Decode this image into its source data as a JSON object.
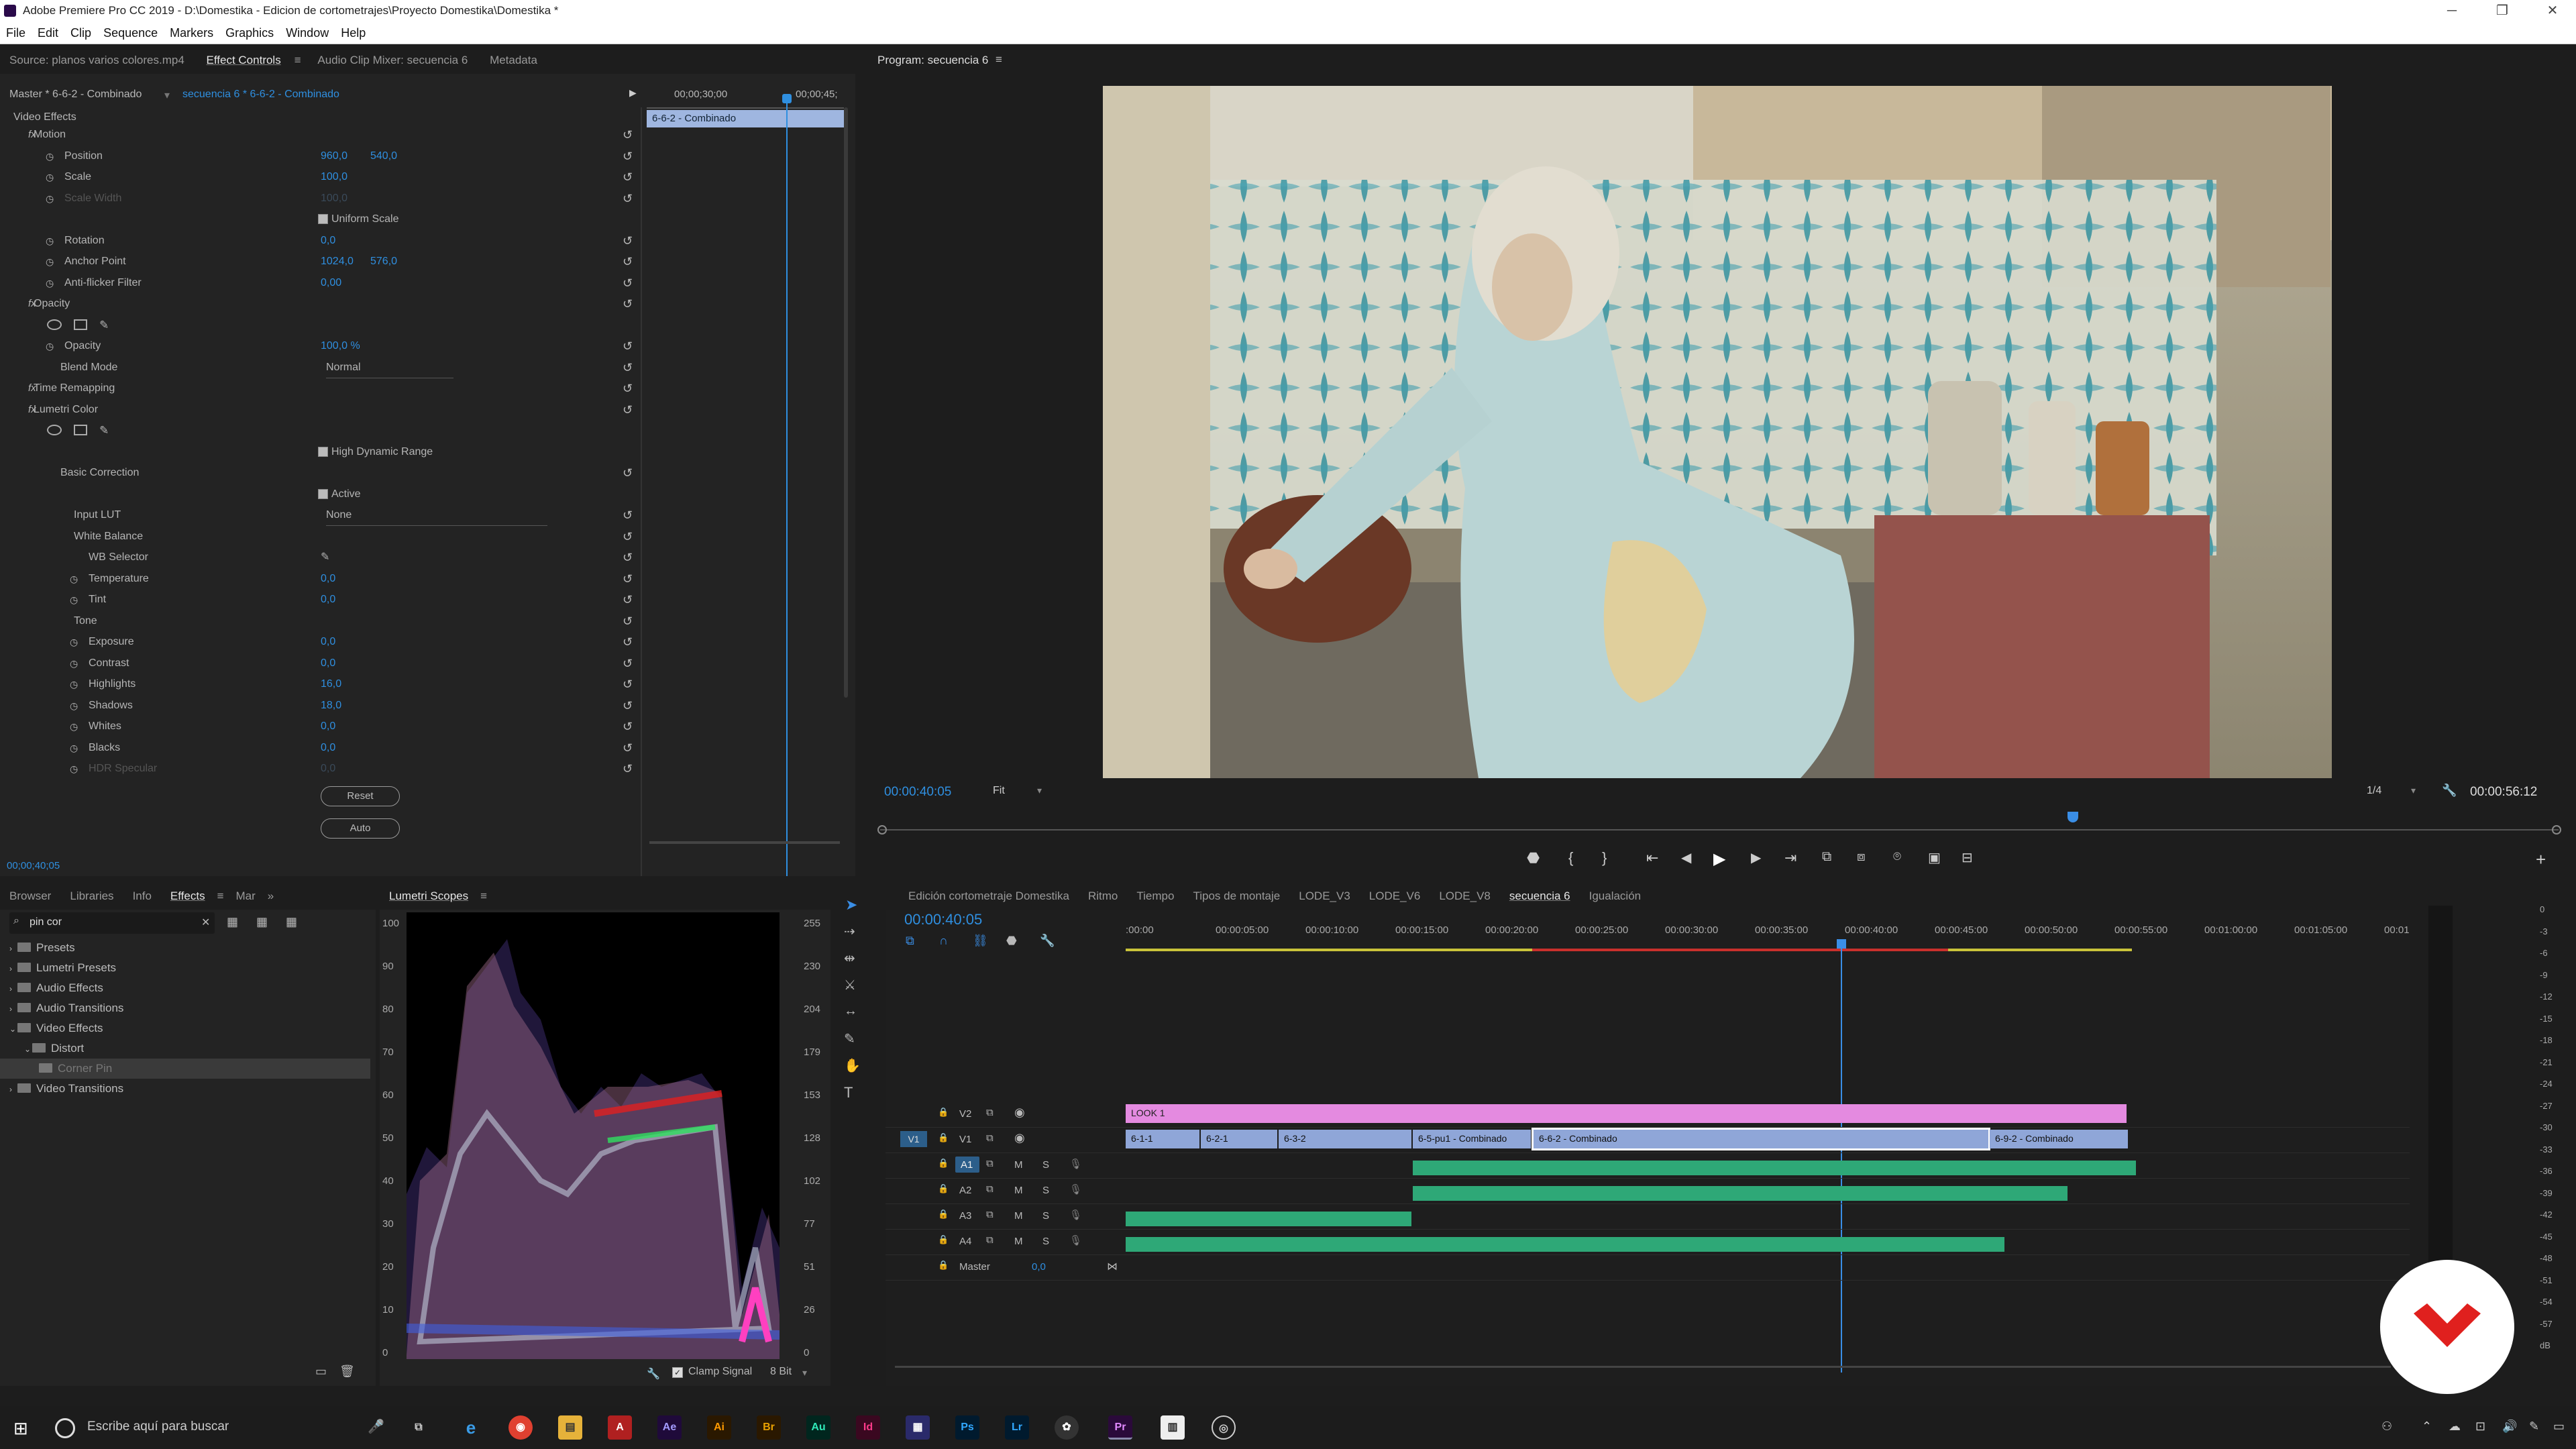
{
  "window": {
    "title": "Adobe Premiere Pro CC 2019 - D:\\Domestika - Edicion de cortometrajes\\Proyecto Domestika\\Domestika *"
  },
  "menu": [
    "File",
    "Edit",
    "Clip",
    "Sequence",
    "Markers",
    "Graphics",
    "Window",
    "Help"
  ],
  "source_panel": {
    "tabs": [
      "Source: planos varios colores.mp4",
      "Effect Controls",
      "Audio Clip Mixer: secuencia 6",
      "Metadata"
    ],
    "active_tab": 1,
    "master": "Master * 6-6-2 - Combinado",
    "sequence": "secuencia 6 * 6-6-2 - Combinado",
    "ruler": [
      "00;00;30;00",
      "00;00;45;"
    ],
    "clip_bar": "6-6-2 - Combinado",
    "timecode": "00;00;40;05",
    "section": "Video Effects",
    "rows": [
      {
        "label": "Motion",
        "indent": 50,
        "fx": true
      },
      {
        "label": "Position",
        "indent": 96,
        "v1": "960,0",
        "v2": "540,0"
      },
      {
        "label": "Scale",
        "indent": 96,
        "v1": "100,0"
      },
      {
        "label": "Scale Width",
        "indent": 96,
        "v1": "100,0",
        "dim": true
      },
      {
        "label": "Uniform Scale",
        "indent": 490,
        "check": true
      },
      {
        "label": "Rotation",
        "indent": 96,
        "v1": "0,0"
      },
      {
        "label": "Anchor Point",
        "indent": 96,
        "v1": "1024,0",
        "v2": "576,0"
      },
      {
        "label": "Anti-flicker Filter",
        "indent": 96,
        "v1": "0,00"
      },
      {
        "label": "Opacity",
        "indent": 50,
        "fx": true
      },
      {
        "label": "",
        "indent": 0,
        "masks": true
      },
      {
        "label": "Opacity",
        "indent": 96,
        "v1": "100,0 %"
      },
      {
        "label": "Blend Mode",
        "indent": 90,
        "sel": "Normal"
      },
      {
        "label": "Time Remapping",
        "indent": 50,
        "fx": true
      },
      {
        "label": "Lumetri Color",
        "indent": 50,
        "fx": true
      },
      {
        "label": "",
        "indent": 0,
        "masks": true
      },
      {
        "label": "High Dynamic Range",
        "indent": 490,
        "check": true
      },
      {
        "label": "Basic Correction",
        "indent": 90
      },
      {
        "label": "Active",
        "indent": 490,
        "check": true
      },
      {
        "label": "Input LUT",
        "indent": 110,
        "sel": "None"
      },
      {
        "label": "White Balance",
        "indent": 110
      },
      {
        "label": "WB Selector",
        "indent": 132
      },
      {
        "label": "Temperature",
        "indent": 132,
        "v1": "0,0"
      },
      {
        "label": "Tint",
        "indent": 132,
        "v1": "0,0"
      },
      {
        "label": "Tone",
        "indent": 110
      },
      {
        "label": "Exposure",
        "indent": 132,
        "v1": "0,0"
      },
      {
        "label": "Contrast",
        "indent": 132,
        "v1": "0,0"
      },
      {
        "label": "Highlights",
        "indent": 132,
        "v1": "16,0"
      },
      {
        "label": "Shadows",
        "indent": 132,
        "v1": "18,0"
      },
      {
        "label": "Whites",
        "indent": 132,
        "v1": "0,0"
      },
      {
        "label": "Blacks",
        "indent": 132,
        "v1": "0,0"
      },
      {
        "label": "HDR Specular",
        "indent": 132,
        "v1": "0,0",
        "dim": true
      }
    ],
    "reset_label": "Reset",
    "auto_label": "Auto"
  },
  "program": {
    "title": "Program: secuencia 6",
    "timecode": "00:00:40:05",
    "fit": "Fit",
    "quality": "1/4",
    "duration": "00:00:56:12"
  },
  "effects_panel": {
    "tabs": [
      "Browser",
      "Libraries",
      "Info",
      "Effects",
      "Mar"
    ],
    "search": "pin cor",
    "tree": [
      {
        "label": "Presets",
        "depth": 0
      },
      {
        "label": "Lumetri Presets",
        "depth": 0
      },
      {
        "label": "Audio Effects",
        "depth": 0
      },
      {
        "label": "Audio Transitions",
        "depth": 0
      },
      {
        "label": "Video Effects",
        "depth": 0
      },
      {
        "label": "Distort",
        "depth": 1
      },
      {
        "label": "Corner Pin",
        "depth": 2,
        "selected": true
      },
      {
        "label": "Video Transitions",
        "depth": 0
      }
    ]
  },
  "scopes": {
    "title": "Lumetri Scopes",
    "left_ticks": [
      "100",
      "90",
      "80",
      "70",
      "60",
      "50",
      "40",
      "30",
      "20",
      "10",
      "0"
    ],
    "right_ticks": [
      "255",
      "230",
      "204",
      "179",
      "153",
      "128",
      "102",
      "77",
      "51",
      "26",
      "0"
    ],
    "clamp": "Clamp Signal",
    "bit": "8 Bit"
  },
  "timeline": {
    "tabs": [
      "Edición cortometraje Domestika",
      "Ritmo",
      "Tiempo",
      "Tipos de montaje",
      "LODE_V3",
      "LODE_V6",
      "LODE_V8",
      "secuencia 6",
      "Igualación"
    ],
    "active_tab": 7,
    "timecode": "00:00:40:05",
    "ruler": [
      ":00:00",
      "00:00:05:00",
      "00:00:10:00",
      "00:00:15:00",
      "00:00:20:00",
      "00:00:25:00",
      "00:00:30:00",
      "00:00:35:00",
      "00:00:40:00",
      "00:00:45:00",
      "00:00:50:00",
      "00:00:55:00",
      "00:01:00:00",
      "00:01:05:00",
      "00:01:"
    ],
    "tracks": [
      "V2",
      "V1",
      "A1",
      "A2",
      "A3",
      "A4",
      "Master"
    ],
    "master_val": "0,0",
    "v2_clip": "LOOK 1",
    "v1_clips": [
      "6-1-1",
      "6-2-1",
      "6-3-2",
      "6-5-pu1 - Combinado",
      "6-6-2 - Combinado",
      "6-9-2 - Combinado"
    ]
  },
  "meter_ticks": [
    "0",
    "-3",
    "-6",
    "-9",
    "-12",
    "-15",
    "-18",
    "-21",
    "-24",
    "-27",
    "-30",
    "-33",
    "-36",
    "-39",
    "-42",
    "-45",
    "-48",
    "-51",
    "-54",
    "-57",
    "dB"
  ],
  "taskbar": {
    "search": "Escribe aquí para buscar"
  }
}
